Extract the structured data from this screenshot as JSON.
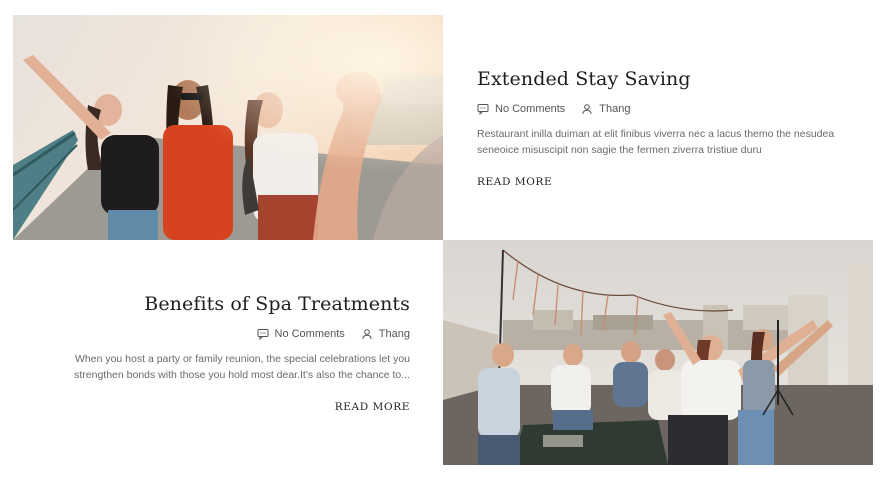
{
  "posts": [
    {
      "title": "Extended Stay Saving",
      "comments": "No Comments",
      "author": "Thang",
      "excerpt": "Restaurant inilla duiman at elit finibus viverra nec a lacus themo the nesudea seneoice misuscipit non sagie the fermen ziverra tristiue duru",
      "read_more": "READ MORE"
    },
    {
      "title": "Benefits of Spa Treatments",
      "comments": "No Comments",
      "author": "Thang",
      "excerpt": "When you host a party or family reunion, the special celebrations let you strengthen bonds with those you hold most dear.It's also the chance to...",
      "read_more": "READ MORE"
    }
  ],
  "icons": {
    "comment": "comment-icon",
    "author": "user-icon"
  }
}
